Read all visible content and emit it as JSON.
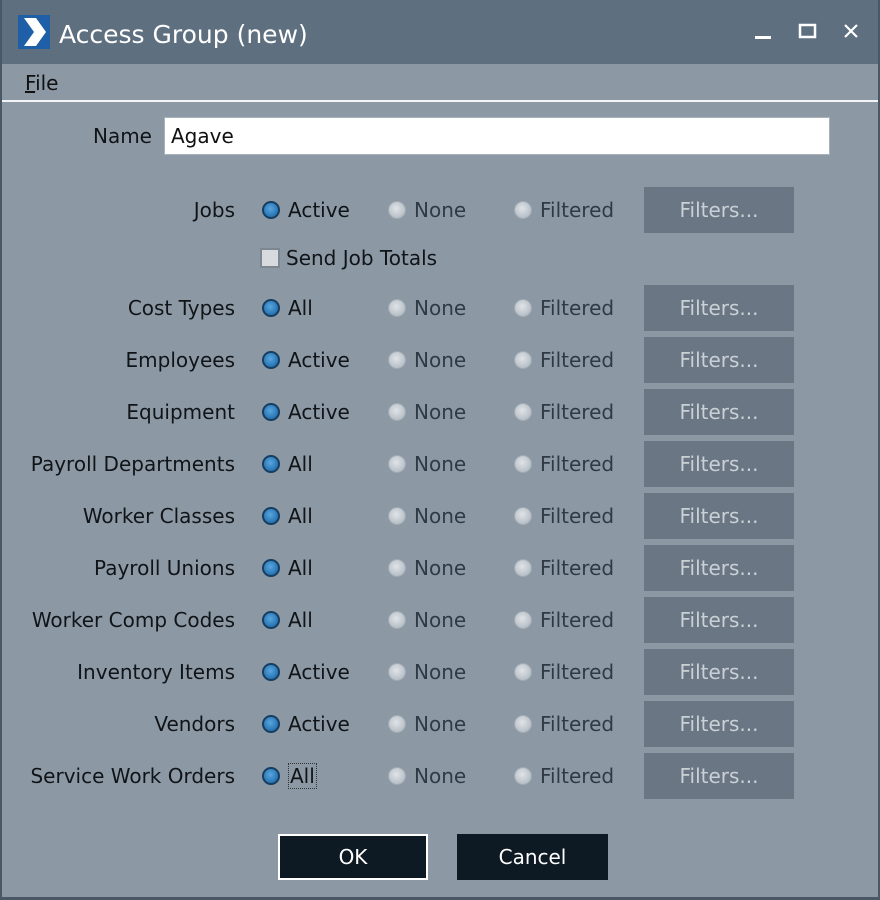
{
  "window": {
    "title": "Access Group (new)",
    "controls": {
      "minimize": "minimize-icon",
      "maximize": "maximize-icon",
      "close": "close-icon"
    }
  },
  "menu": {
    "file_label": "File",
    "file_mnemonic": "F",
    "file_rest": "ile"
  },
  "name_field": {
    "label": "Name",
    "value": "Agave"
  },
  "send_job_totals": {
    "label": "Send Job Totals",
    "checked": false
  },
  "filters_label": "Filters...",
  "rows": [
    {
      "label": "Jobs",
      "options": [
        "Active",
        "None",
        "Filtered"
      ],
      "selected": 0
    },
    {
      "label": "Cost Types",
      "options": [
        "All",
        "None",
        "Filtered"
      ],
      "selected": 0
    },
    {
      "label": "Employees",
      "options": [
        "Active",
        "None",
        "Filtered"
      ],
      "selected": 0
    },
    {
      "label": "Equipment",
      "options": [
        "Active",
        "None",
        "Filtered"
      ],
      "selected": 0
    },
    {
      "label": "Payroll Departments",
      "options": [
        "All",
        "None",
        "Filtered"
      ],
      "selected": 0
    },
    {
      "label": "Worker Classes",
      "options": [
        "All",
        "None",
        "Filtered"
      ],
      "selected": 0
    },
    {
      "label": "Payroll Unions",
      "options": [
        "All",
        "None",
        "Filtered"
      ],
      "selected": 0
    },
    {
      "label": "Worker Comp Codes",
      "options": [
        "All",
        "None",
        "Filtered"
      ],
      "selected": 0
    },
    {
      "label": "Inventory Items",
      "options": [
        "Active",
        "None",
        "Filtered"
      ],
      "selected": 0
    },
    {
      "label": "Vendors",
      "options": [
        "Active",
        "None",
        "Filtered"
      ],
      "selected": 0
    },
    {
      "label": "Service Work Orders",
      "options": [
        "All",
        "None",
        "Filtered"
      ],
      "selected": 0
    }
  ],
  "buttons": {
    "ok": "OK",
    "cancel": "Cancel"
  },
  "colors": {
    "accent_radio": "#2a78b8",
    "titlebar": "#5e6f80",
    "dialog_bg": "#8c99a4",
    "dark_button": "#0d1a24"
  }
}
